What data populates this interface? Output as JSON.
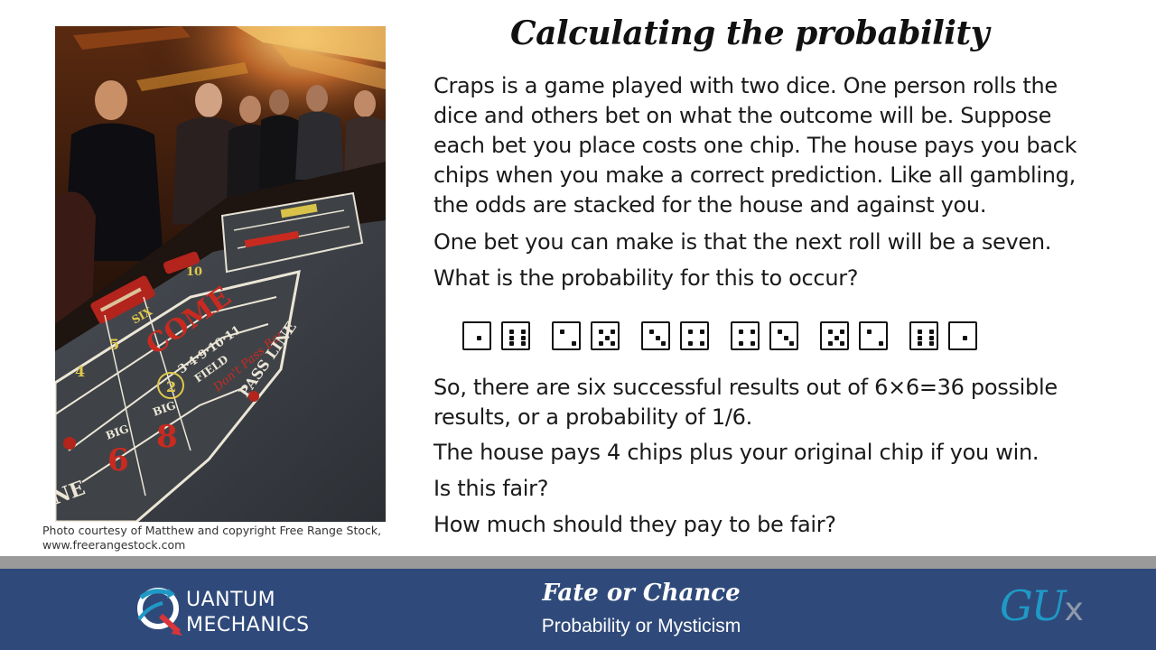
{
  "slide": {
    "title": "Calculating the probability",
    "paragraphs": [
      [
        "Craps is a game played with two dice. One person rolls the",
        "dice and others bet on what the outcome will be. Suppose",
        "each bet you place costs one chip. The house pays you back",
        "chips when you make a correct prediction. Like all gambling,",
        "the odds are stacked for the house and against you."
      ],
      [
        "One bet you can make is that the next roll will be a seven."
      ],
      [
        "What is the probability for this to occur?"
      ],
      [
        "So, there are six successful results out of 6×6=36 possible",
        "results, or a probability of 1/6."
      ],
      [
        "The house pays 4 chips plus your original chip if you win."
      ],
      [
        "Is this fair?"
      ],
      [
        "How much should they pay to be fair?"
      ]
    ],
    "dice_pairs": [
      [
        1,
        6
      ],
      [
        2,
        5
      ],
      [
        3,
        4
      ],
      [
        4,
        3
      ],
      [
        5,
        2
      ],
      [
        6,
        1
      ]
    ]
  },
  "photo": {
    "caption_lines": [
      "Photo courtesy of Matthew and copyright Free Range Stock,",
      "www.freerangestock.com"
    ],
    "table_text": {
      "come": "COME",
      "field": "FIELD",
      "field_numbers": "3·4·9·10·11",
      "dont_pass": "Don't Pass Bar",
      "pass_line": "PASS LINE",
      "big_six": "BIG",
      "six": "6",
      "big_eight": "BIG",
      "eight": "8",
      "numbers": [
        "4",
        "5",
        "SIX",
        "10"
      ],
      "line_fragment": "NE",
      "hardway": "2"
    }
  },
  "footer": {
    "logo_lines": [
      "UANTUM",
      "MECHANICS"
    ],
    "course_title": "Fate or Chance",
    "course_subtitle": "Probability or Mysticism",
    "brand": "GU",
    "brand_suffix": "x"
  },
  "colors": {
    "footer_bg": "#2f4a7a",
    "footer_stripe": "#9a9a9a",
    "brand_blue": "#1f99c6",
    "logo_red": "#d8343a",
    "felt": "#3a3e44",
    "table_red": "#c92a20"
  }
}
